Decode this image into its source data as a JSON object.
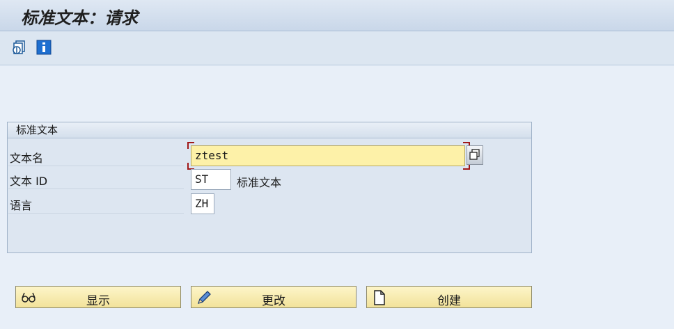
{
  "window": {
    "title": "标准文本：请求"
  },
  "toolbar": {
    "icons": [
      {
        "name": "other-text-icon"
      },
      {
        "name": "info-icon"
      }
    ]
  },
  "group": {
    "title": "标准文本",
    "fields": {
      "text_name": {
        "label": "文本名",
        "value": "ztest"
      },
      "text_id": {
        "label": "文本 ID",
        "value": "ST",
        "description": "标准文本"
      },
      "language": {
        "label": "语言",
        "value": "ZH"
      }
    }
  },
  "buttons": {
    "display": "显示",
    "change": "更改",
    "create": "创建"
  },
  "colors": {
    "background": "#e8eff8",
    "required_field": "#fdf1a8",
    "button": "#f2e29a"
  }
}
